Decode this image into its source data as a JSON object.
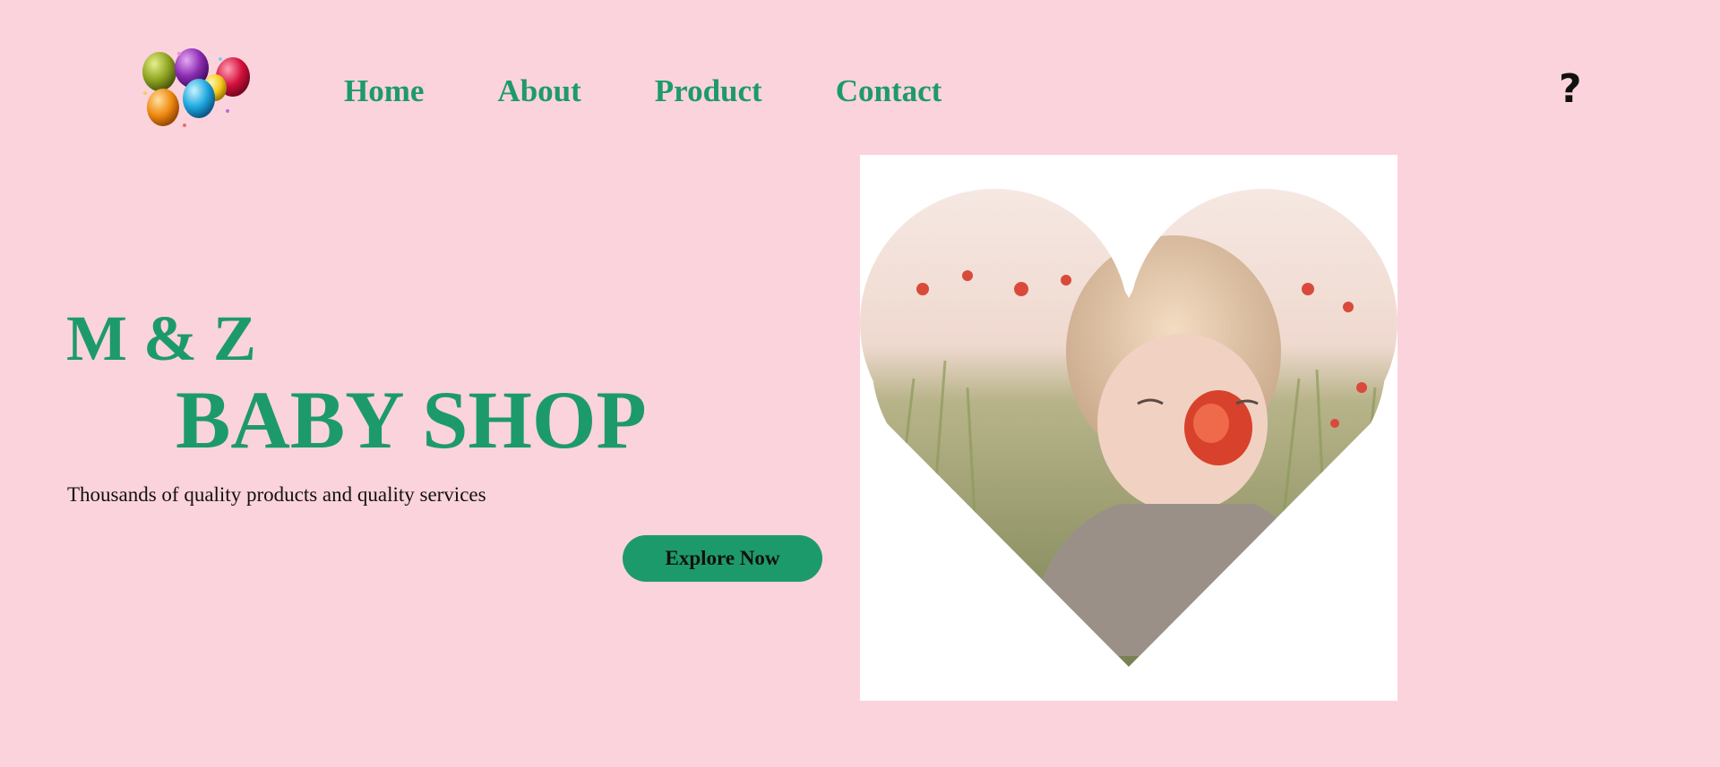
{
  "nav": {
    "items": [
      {
        "label": "Home"
      },
      {
        "label": "About"
      },
      {
        "label": "Product"
      },
      {
        "label": "Contact"
      }
    ],
    "help_label": "?"
  },
  "hero": {
    "brand_line1": "M & Z",
    "brand_line2": "BABY SHOP",
    "tagline": "Thousands of quality products and quality services",
    "cta_label": "Explore Now"
  },
  "icons": {
    "logo": "balloons-logo-icon",
    "help": "question-mark-icon"
  },
  "colors": {
    "background": "#fbd3dc",
    "accent": "#1d9a6c",
    "text": "#111111",
    "image_frame": "#ffffff"
  }
}
